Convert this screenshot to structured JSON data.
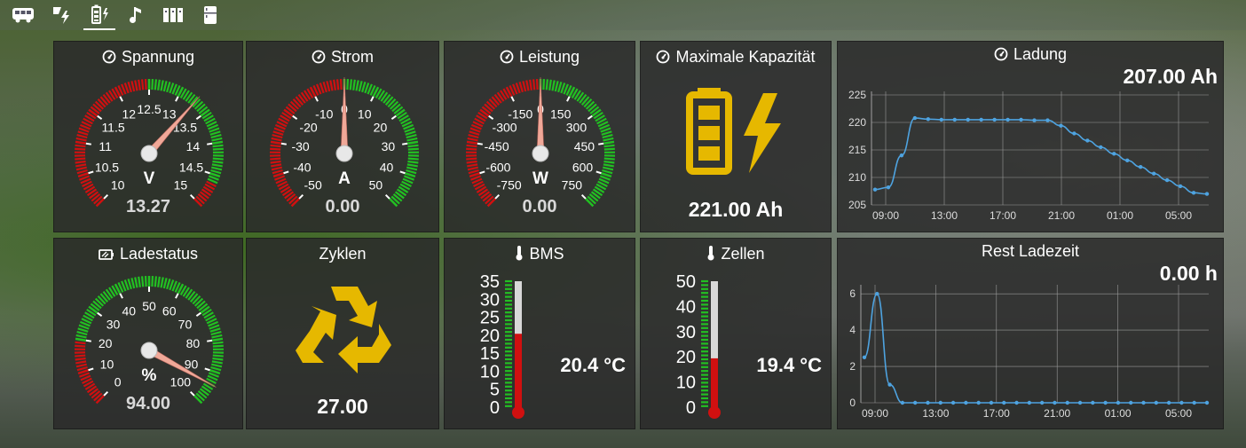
{
  "nav": {
    "items": [
      {
        "name": "nav-bus",
        "icon": "bus-icon",
        "active": false
      },
      {
        "name": "nav-solar",
        "icon": "solar-charge-icon",
        "active": false
      },
      {
        "name": "nav-battery",
        "icon": "battery-charge-icon",
        "active": true
      },
      {
        "name": "nav-music",
        "icon": "music-icon",
        "active": false
      },
      {
        "name": "nav-sections",
        "icon": "columns-icon",
        "active": false
      },
      {
        "name": "nav-device",
        "icon": "fridge-icon",
        "active": false
      }
    ]
  },
  "spannung": {
    "title": "Spannung",
    "unit": "V",
    "value_text": "13.27",
    "value": 13.27,
    "min": 10,
    "max": 15,
    "ticks": [
      "10",
      "10.5",
      "11",
      "11.5",
      "12",
      "12.5",
      "13",
      "13.5",
      "14",
      "14.5",
      "15"
    ]
  },
  "strom": {
    "title": "Strom",
    "unit": "A",
    "value_text": "0.00",
    "value": 0,
    "min": -50,
    "max": 50,
    "ticks": [
      "-50",
      "-40",
      "-30",
      "-20",
      "-10",
      "0",
      "10",
      "20",
      "30",
      "40",
      "50"
    ]
  },
  "leistung": {
    "title": "Leistung",
    "unit": "W",
    "value_text": "0.00",
    "value": 0,
    "min": -750,
    "max": 750,
    "ticks": [
      "-750",
      "-600",
      "-450",
      "-300",
      "-150",
      "0",
      "150",
      "300",
      "450",
      "600",
      "750"
    ]
  },
  "kapazitaet": {
    "title": "Maximale Kapazität",
    "value_text": "221.00 Ah",
    "icon": "battery-charging-icon"
  },
  "ladung": {
    "title": "Ladung",
    "value_text": "207.00 Ah"
  },
  "ladestatus": {
    "title": "Ladestatus",
    "unit": "%",
    "value_text": "94.00",
    "value": 94,
    "min": 0,
    "max": 100,
    "ticks": [
      "0",
      "10",
      "20",
      "30",
      "40",
      "50",
      "60",
      "70",
      "80",
      "90",
      "100"
    ]
  },
  "zyklen": {
    "title": "Zyklen",
    "value_text": "27.00",
    "icon": "recycle-icon"
  },
  "bms": {
    "title": "BMS",
    "value_text": "20.4 °C",
    "value": 20.4,
    "max": 35,
    "ticks": [
      "35",
      "30",
      "25",
      "20",
      "15",
      "10",
      "5",
      "0"
    ]
  },
  "zellen": {
    "title": "Zellen",
    "value_text": "19.4 °C",
    "value": 19.4,
    "max": 50,
    "ticks": [
      "50",
      "40",
      "30",
      "20",
      "10",
      "0"
    ]
  },
  "restladezeit": {
    "title": "Rest Ladezeit",
    "value_text": "0.00 h"
  },
  "colors": {
    "accent": "#e6b800",
    "line": "#4ea3e0",
    "green": "#22c022",
    "red": "#d01010"
  },
  "chart_data": [
    {
      "type": "line",
      "title": "Ladung",
      "xlabel": "",
      "ylabel": "",
      "x_ticks": [
        "09:00",
        "13:00",
        "17:00",
        "21:00",
        "01:00",
        "05:00"
      ],
      "y_ticks": [
        "205",
        "210",
        "215",
        "220",
        "225"
      ],
      "ylim": [
        205,
        225
      ],
      "series": [
        {
          "values": [
            207.8,
            208.2,
            214,
            220.8,
            220.6,
            220.5,
            220.5,
            220.5,
            220.5,
            220.5,
            220.5,
            220.5,
            220.4,
            220.4,
            219.4,
            218,
            216.7,
            215.5,
            214.3,
            213.1,
            211.9,
            210.7,
            209.5,
            208.4,
            207.2,
            207
          ]
        }
      ]
    },
    {
      "type": "line",
      "title": "Rest Ladezeit",
      "xlabel": "",
      "ylabel": "",
      "x_ticks": [
        "09:00",
        "13:00",
        "17:00",
        "21:00",
        "01:00",
        "05:00"
      ],
      "y_ticks": [
        "0",
        "2",
        "4",
        "6"
      ],
      "ylim": [
        0,
        6.3
      ],
      "series": [
        {
          "values": [
            2.5,
            6,
            1,
            0,
            0,
            0,
            0,
            0,
            0,
            0,
            0,
            0,
            0,
            0,
            0,
            0,
            0,
            0,
            0,
            0,
            0,
            0,
            0,
            0,
            0,
            0,
            0,
            0
          ]
        }
      ]
    }
  ]
}
